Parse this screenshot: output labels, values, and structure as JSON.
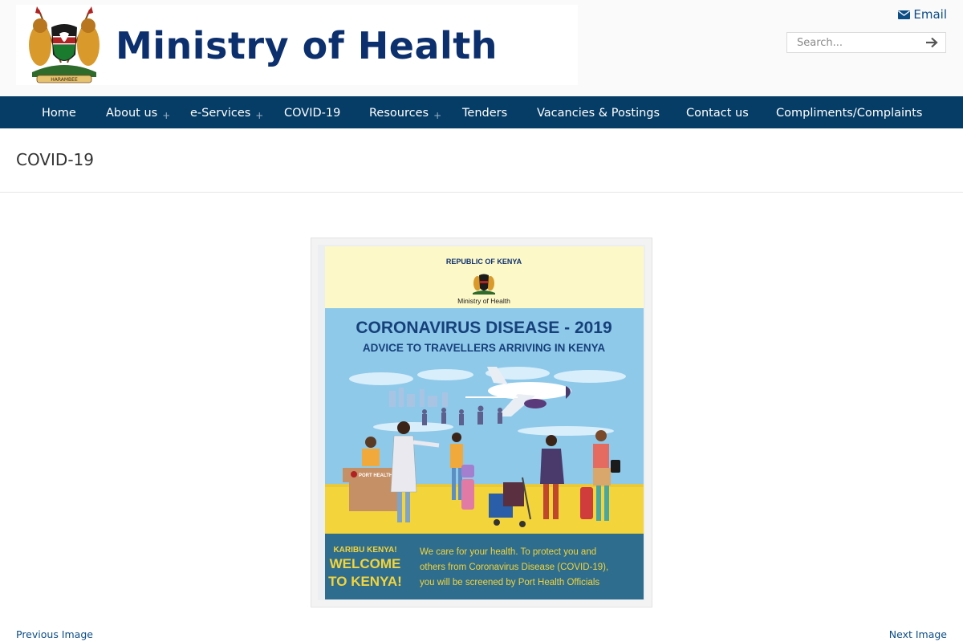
{
  "header": {
    "site_title": "Ministry of Health",
    "email_label": "Email",
    "search_placeholder": "Search..."
  },
  "nav": {
    "items": [
      {
        "label": "Home",
        "has_submenu": false
      },
      {
        "label": "About us",
        "has_submenu": true
      },
      {
        "label": "e-Services",
        "has_submenu": true
      },
      {
        "label": "COVID-19",
        "has_submenu": false
      },
      {
        "label": "Resources",
        "has_submenu": true
      },
      {
        "label": "Tenders",
        "has_submenu": false
      },
      {
        "label": "Vacancies & Postings",
        "has_submenu": false
      },
      {
        "label": "Contact us",
        "has_submenu": false
      },
      {
        "label": "Compliments/Complaints",
        "has_submenu": false
      }
    ],
    "submenu_marker": "+"
  },
  "page": {
    "title": "COVID-19"
  },
  "poster": {
    "republic": "REPUBLIC OF KENYA",
    "ministry": "Ministry of Health",
    "headline": "CORONAVIRUS DISEASE - 2019",
    "subheadline": "ADVICE TO TRAVELLERS ARRIVING IN KENYA",
    "desk_label": "PORT HEALTH",
    "karibu": "KARIBU KENYA!",
    "welcome_line1": "WELCOME",
    "welcome_line2": "TO KENYA!",
    "message_line1": "We care for your health. To protect you and",
    "message_line2": "others from Coronavirus Disease (COVID-19),",
    "message_line3": "you will be screened by Port Health Officials"
  },
  "pager": {
    "previous_label": "Previous Image",
    "next_label": "Next Image"
  },
  "colors": {
    "nav_bg": "#063d66",
    "title_blue": "#0c2f6e",
    "link_blue": "#0d4d86",
    "poster_sky": "#8ec9ea",
    "poster_cream": "#fdf8c8",
    "poster_yellow": "#f3d43a",
    "poster_bottom": "#2e6d8e"
  },
  "icons": [
    "coat-of-arms-icon",
    "envelope-icon",
    "arrow-right-icon"
  ]
}
